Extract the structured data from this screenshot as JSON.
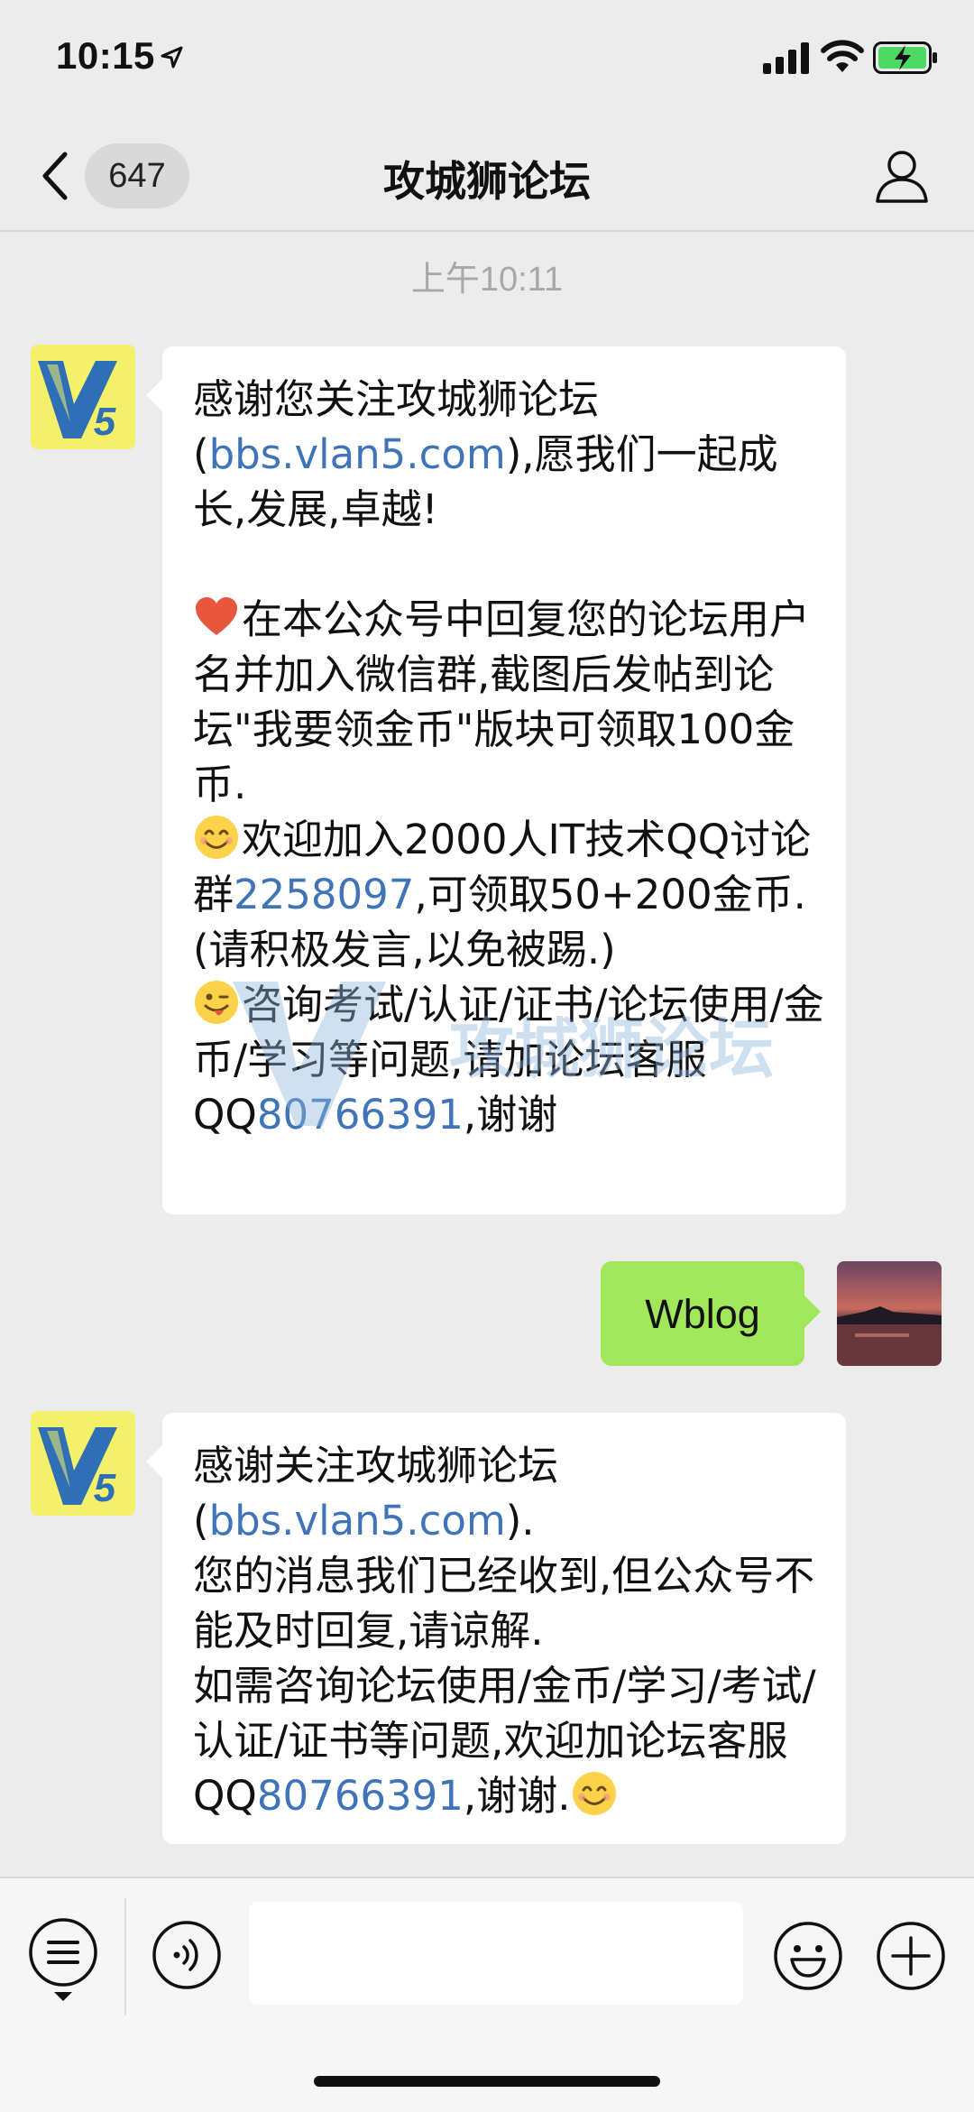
{
  "status_bar": {
    "time": "10:15",
    "battery_color": "#4cd964"
  },
  "nav": {
    "unread_count": "647",
    "title": "攻城狮论坛"
  },
  "chat": {
    "timestamp": "上午10:11",
    "messages": [
      {
        "sender": "official",
        "avatar_text": "V5",
        "lines": {
          "l1_text": "感谢您关注攻城狮论坛(",
          "l1_link": "bbs.vlan5.com",
          "l1_after": "),愿我们一起成长,发展,卓越!",
          "p2_icon": "heart-emoji",
          "p2_text": "在本公众号中回复您的论坛用户名并加入微信群,截图后发帖到论坛\"我要领金币\"版块可领取100金币.",
          "p3_icon": "smile-emoji",
          "p3_text_a": "欢迎加入2000人IT技术QQ讨论群",
          "p3_link": "2258097",
          "p3_text_b": ",可领取50+200金币.(请积极发言,以免被踢.)",
          "p4_icon": "wink-tongue-emoji",
          "p4_text": "咨询考试/认证/证书/论坛使用/金币/学习等问题,请加论坛客服QQ",
          "p4_link": "80766391",
          "p4_after": ",谢谢"
        }
      },
      {
        "sender": "me",
        "text": "Wblog"
      },
      {
        "sender": "official",
        "avatar_text": "V5",
        "lines": {
          "l1_text": "感谢关注攻城狮论坛(",
          "l1_link": "bbs.vlan5.com",
          "l1_after": ").",
          "l2": "您的消息我们已经收到,但公众号不能及时回复,请谅解.",
          "l3_text": "如需咨询论坛使用/金币/学习/考试/认证/证书等问题,欢迎加论坛客服QQ",
          "l3_link": "80766391",
          "l3_after": ",谢谢.",
          "l3_icon": "smile-emoji"
        }
      }
    ]
  },
  "watermark": {
    "text": "攻城狮论坛"
  },
  "input_bar": {
    "placeholder": ""
  },
  "colors": {
    "background": "#ececec",
    "bubble_self": "#a0e75a",
    "bubble_other": "#ffffff",
    "link": "#3f74b8",
    "avatar_bg": "#f4f06a",
    "avatar_fg": "#2f6fb5"
  }
}
